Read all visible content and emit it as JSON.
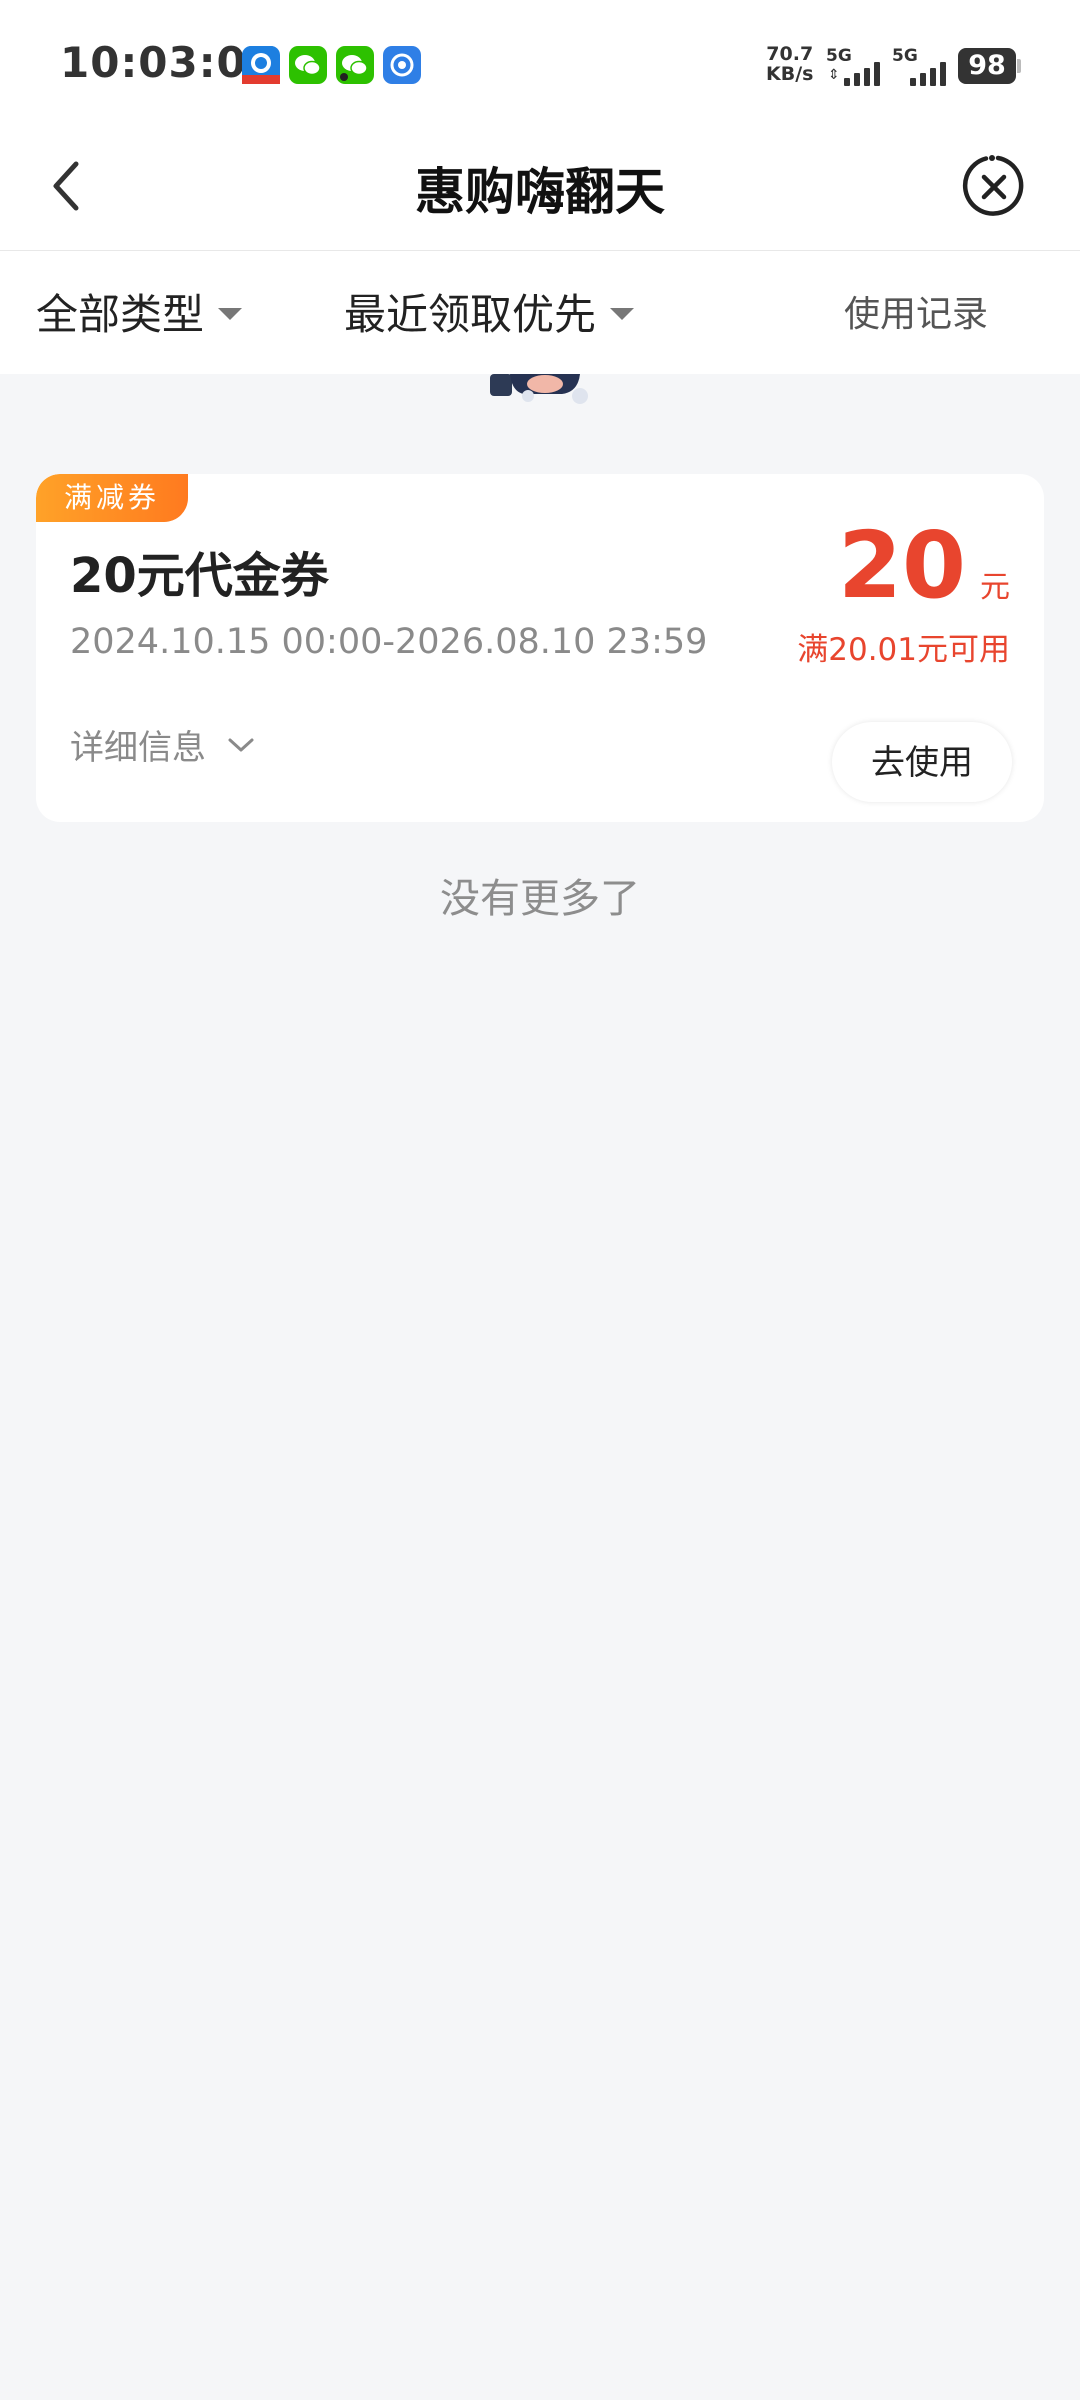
{
  "status_bar": {
    "time": "10:03:07",
    "net_speed_value": "70.7",
    "net_speed_unit": "KB/s",
    "sim1_label": "5G",
    "sim2_label": "5G",
    "battery": "98",
    "notification_icons": [
      "alipay-like-app-icon",
      "wechat-icon",
      "wechat-icon",
      "blue-app-icon"
    ]
  },
  "nav": {
    "title": "惠购嗨翻天",
    "back_icon": "chevron-left-icon",
    "close_icon": "close-circle-icon"
  },
  "filters": {
    "type_label": "全部类型",
    "sort_label": "最近领取优先",
    "record_label": "使用记录"
  },
  "coupons": [
    {
      "badge": "满减券",
      "name": "20元代金券",
      "validity": "2024.10.15 00:00-2026.08.10 23:59",
      "amount": "20",
      "unit": "元",
      "condition": "满20.01元可用",
      "detail_label": "详细信息",
      "use_label": "去使用"
    }
  ],
  "footer": {
    "no_more": "没有更多了"
  },
  "colors": {
    "accent_red": "#e8452e",
    "badge_orange": "#ff8a24",
    "background": "#f5f6f8"
  }
}
